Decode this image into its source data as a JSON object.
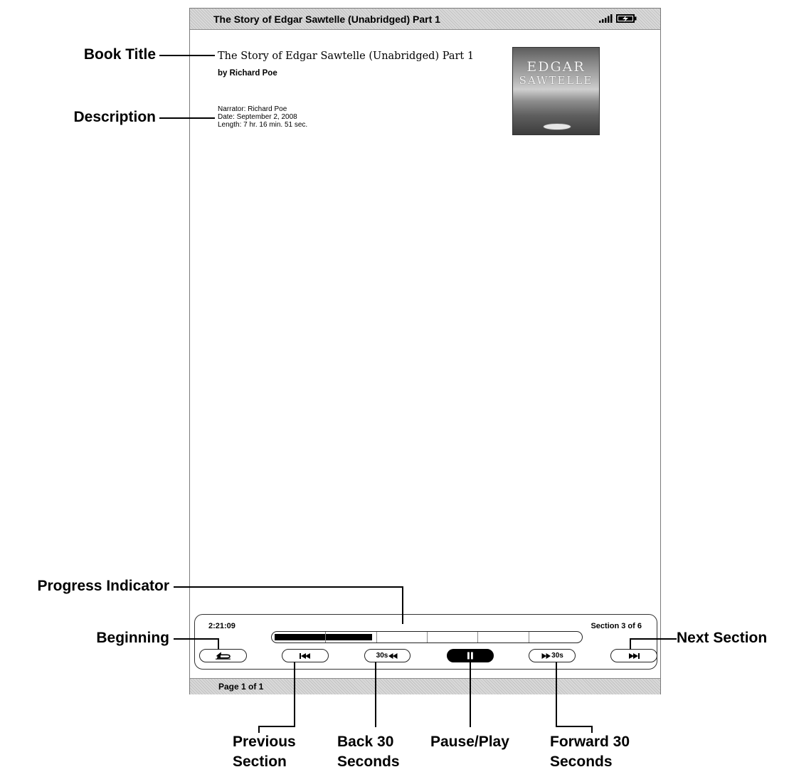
{
  "device": {
    "title_bar": "The Story of Edgar Sawtelle (Unabridged) Part 1",
    "status_icons": [
      "signal-strength-icon",
      "battery-charging-icon"
    ],
    "book": {
      "title": "The Story of Edgar Sawtelle (Unabridged) Part 1",
      "author": "by Richard Poe",
      "narrator": "Narrator: Richard Poe",
      "date": "Date: September 2, 2008",
      "length": "Length: 7 hr. 16 min. 51 sec.",
      "cover": {
        "line1": "EDGAR",
        "line2": "SAWTELLE"
      }
    },
    "player": {
      "elapsed": "2:21:09",
      "section": "Section 3 of 6",
      "progress_fraction": 0.32,
      "section_count": 6,
      "controls": {
        "beginning_icon": "return-to-beginning-icon",
        "previous_icon": "skip-back-icon",
        "back30_label": "30s",
        "back30_icon": "rewind-icon",
        "pause_icon": "pause-icon",
        "forward30_label": "30s",
        "forward30_icon": "fast-forward-icon",
        "next_icon": "skip-forward-icon"
      }
    },
    "footer": {
      "page": "Page 1 of 1"
    }
  },
  "callouts": {
    "book_title": "Book Title",
    "description": "Description",
    "progress_indicator": "Progress Indicator",
    "beginning": "Beginning",
    "next_section": "Next Section",
    "previous_section": [
      "Previous",
      "Section"
    ],
    "back_30": [
      "Back 30",
      "Seconds"
    ],
    "pause_play": "Pause/Play",
    "forward_30": [
      "Forward 30",
      "Seconds"
    ]
  }
}
